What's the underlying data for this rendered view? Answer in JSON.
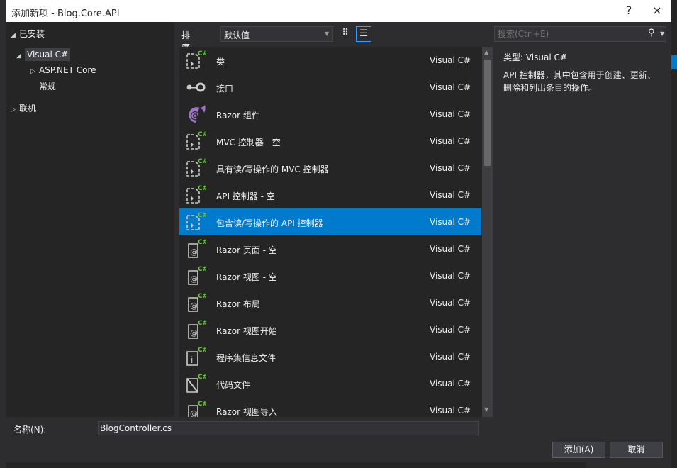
{
  "window": {
    "title": "添加新项 - Blog.Core.API",
    "help": "?",
    "close": "×"
  },
  "tree": {
    "installed": "已安装",
    "visual_csharp": "Visual C#",
    "aspnet_core": "ASP.NET Core",
    "general": "常规",
    "online": "联机"
  },
  "toolbar": {
    "sort_label": "排序依据:",
    "sort_value": "默认值",
    "grid_view_icon": "grid-icon",
    "list_view_icon": "list-icon"
  },
  "items": [
    {
      "name": "类",
      "lang": "Visual C#",
      "icon": "class"
    },
    {
      "name": "接口",
      "lang": "Visual C#",
      "icon": "interface"
    },
    {
      "name": "Razor 组件",
      "lang": "Visual C#",
      "icon": "razor-component"
    },
    {
      "name": "MVC 控制器 - 空",
      "lang": "Visual C#",
      "icon": "class"
    },
    {
      "name": "具有读/写操作的 MVC 控制器",
      "lang": "Visual C#",
      "icon": "class"
    },
    {
      "name": "API 控制器 - 空",
      "lang": "Visual C#",
      "icon": "class"
    },
    {
      "name": "包含读/写操作的 API 控制器",
      "lang": "Visual C#",
      "icon": "class",
      "selected": true
    },
    {
      "name": "Razor 页面 - 空",
      "lang": "Visual C#",
      "icon": "razor"
    },
    {
      "name": "Razor 视图 - 空",
      "lang": "Visual C#",
      "icon": "razor"
    },
    {
      "name": "Razor 布局",
      "lang": "Visual C#",
      "icon": "razor"
    },
    {
      "name": "Razor 视图开始",
      "lang": "Visual C#",
      "icon": "razor"
    },
    {
      "name": "程序集信息文件",
      "lang": "Visual C#",
      "icon": "info"
    },
    {
      "name": "代码文件",
      "lang": "Visual C#",
      "icon": "code"
    },
    {
      "name": "Razor 视图导入",
      "lang": "Visual C#",
      "icon": "razor"
    }
  ],
  "search": {
    "placeholder": "搜索(Ctrl+E)"
  },
  "detail": {
    "type": "类型:  Visual C#",
    "description": "API 控制器，其中包含用于创建、更新、删除和列出条目的操作。"
  },
  "footer": {
    "name_label": "名称(N):",
    "name_value": "BlogController.cs",
    "add": "添加(A)",
    "cancel": "取消"
  },
  "colors": {
    "accent": "#007acc",
    "background": "#2d2d30",
    "csharp_badge": "#6cc24a",
    "razor": "#a074c4"
  }
}
